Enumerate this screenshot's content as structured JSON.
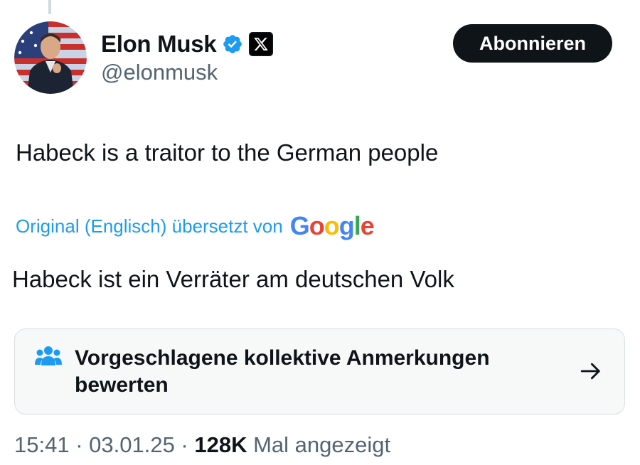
{
  "author": {
    "display_name": "Elon Musk",
    "handle": "@elonmusk",
    "verified": true,
    "affiliate_badge": "x-logo-icon"
  },
  "follow_button": {
    "label": "Abonnieren"
  },
  "tweet": {
    "text": "Habeck is a traitor to the German people"
  },
  "translation": {
    "label": "Original (Englisch) übersetzt von",
    "provider": "Google",
    "provider_colors": [
      "#4285F4",
      "#EA4335",
      "#FBBC05",
      "#4285F4",
      "#34A853",
      "#EA4335"
    ],
    "text": "Habeck ist ein Verräter am deutschen Volk"
  },
  "community_notes": {
    "label": "Vorgeschlagene kollektive Anmerkungen bewerten",
    "icon": "people-icon",
    "arrow_icon": "arrow-right-icon"
  },
  "meta": {
    "time": "15:41",
    "separator": " · ",
    "date": "03.01.25",
    "views_count": "128K",
    "views_label": "Mal angezeigt"
  },
  "colors": {
    "link_blue": "#1d9bf0",
    "secondary_text": "#536471",
    "primary_text": "#0f1419",
    "verified_blue": "#1d9bf0"
  }
}
